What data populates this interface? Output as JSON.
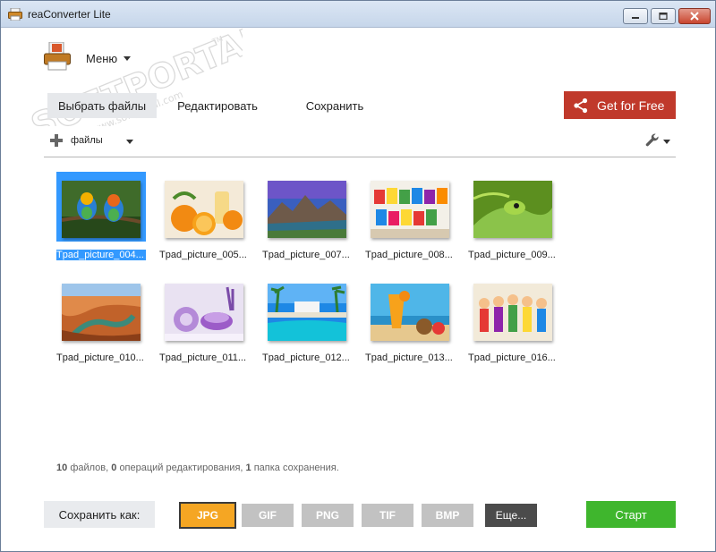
{
  "window": {
    "title": "reaConverter Lite",
    "icons": {
      "app": "printer-app-icon",
      "minimize": "minimize-icon",
      "maximize": "maximize-icon",
      "close": "close-icon"
    }
  },
  "menu": {
    "label": "Меню"
  },
  "watermark": {
    "text": "SOFTPORTAL",
    "url": "www.softportal.com",
    "tm": "TM"
  },
  "tabs": [
    {
      "label": "Выбрать файлы",
      "active": true
    },
    {
      "label": "Редактировать",
      "active": false
    },
    {
      "label": "Сохранить",
      "active": false
    }
  ],
  "get_free": {
    "label": "Get for Free",
    "color": "#c0392b",
    "icon": "share-icon"
  },
  "toolbar": {
    "files_label": "файлы",
    "add_icon": "plus-icon",
    "settings_icon": "wrench-icon"
  },
  "thumbnails": [
    {
      "name": "Tpad_picture_004...",
      "selected": true,
      "subject": "parrots"
    },
    {
      "name": "Tpad_picture_005...",
      "selected": false,
      "subject": "oranges"
    },
    {
      "name": "Tpad_picture_007...",
      "selected": false,
      "subject": "mountains"
    },
    {
      "name": "Tpad_picture_008...",
      "selected": false,
      "subject": "colorful-jars"
    },
    {
      "name": "Tpad_picture_009...",
      "selected": false,
      "subject": "green-snake"
    },
    {
      "name": "Tpad_picture_010...",
      "selected": false,
      "subject": "canyon"
    },
    {
      "name": "Tpad_picture_011...",
      "selected": false,
      "subject": "lavender-spa"
    },
    {
      "name": "Tpad_picture_012...",
      "selected": false,
      "subject": "pool-resort"
    },
    {
      "name": "Tpad_picture_013...",
      "selected": false,
      "subject": "beach-cocktail"
    },
    {
      "name": "Tpad_picture_016...",
      "selected": false,
      "subject": "fairies"
    }
  ],
  "status": {
    "files_count": "10",
    "files_text": "файлов,",
    "ops_count": "0",
    "ops_text": "операций редактирования,",
    "folders_count": "1",
    "folders_text": "папка сохранения."
  },
  "bottom": {
    "save_as_label": "Сохранить как:",
    "formats": [
      {
        "label": "JPG",
        "selected": true
      },
      {
        "label": "GIF",
        "selected": false
      },
      {
        "label": "PNG",
        "selected": false
      },
      {
        "label": "TIF",
        "selected": false
      },
      {
        "label": "BMP",
        "selected": false
      },
      {
        "label": "Еще...",
        "selected": false
      }
    ],
    "start_label": "Старт",
    "colors": {
      "jpg": "#f5a623",
      "format": "#c2c2c2",
      "more": "#4b4b4b",
      "start": "#3fb62d"
    }
  }
}
